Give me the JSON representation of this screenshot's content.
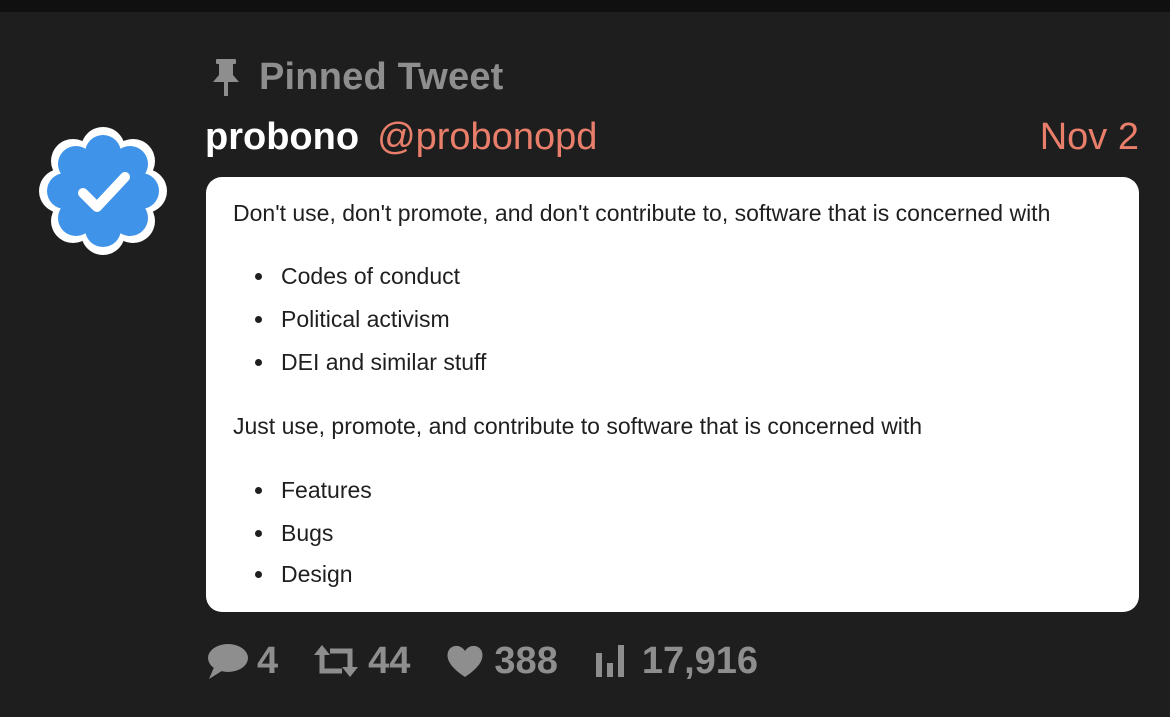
{
  "pinned": {
    "label": "Pinned Tweet",
    "icon": "pin-icon"
  },
  "author": {
    "avatar_icon": "verified-badge-icon",
    "display_name": "probono",
    "handle": "@probonopd",
    "date": "Nov 2"
  },
  "tweet": {
    "intro": "Don't use, don't promote, and don't contribute to, software that is concerned with",
    "avoid_items": [
      "Codes of conduct",
      "Political activism",
      "DEI and similar stuff"
    ],
    "outro": "Just use, promote, and contribute to software that is concerned with",
    "focus_items": [
      "Features",
      "Bugs",
      "Design"
    ]
  },
  "stats": {
    "replies": "4",
    "retweets": "44",
    "likes": "388",
    "views": "17,916"
  },
  "colors": {
    "background": "#1e1e1f",
    "muted": "#8e8e8e",
    "accent": "#e97f6a",
    "verified_blue": "#3f93e8",
    "card": "#ffffff"
  }
}
